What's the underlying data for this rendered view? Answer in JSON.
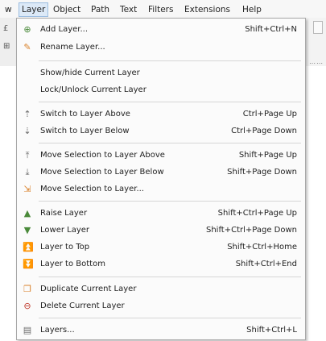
{
  "menubar": {
    "items": [
      {
        "label": "w"
      },
      {
        "label": "Layer"
      },
      {
        "label": "Object"
      },
      {
        "label": "Path"
      },
      {
        "label": "Text"
      },
      {
        "label": "Filters"
      },
      {
        "label": "Extensions"
      },
      {
        "label": "Help"
      }
    ]
  },
  "layer_menu": {
    "items": [
      {
        "label": "Add Layer...",
        "shortcut": "Shift+Ctrl+N",
        "icon": "add-layer-icon"
      },
      {
        "label": "Rename Layer...",
        "shortcut": "",
        "icon": "rename-layer-icon"
      },
      {
        "label": "Show/hide Current Layer",
        "shortcut": "",
        "icon": ""
      },
      {
        "label": "Lock/Unlock Current Layer",
        "shortcut": "",
        "icon": ""
      },
      {
        "label": "Switch to Layer Above",
        "shortcut": "Ctrl+Page Up",
        "icon": "switch-layer-above-icon"
      },
      {
        "label": "Switch to Layer Below",
        "shortcut": "Ctrl+Page Down",
        "icon": "switch-layer-below-icon"
      },
      {
        "label": "Move Selection to Layer Above",
        "shortcut": "Shift+Page Up",
        "icon": "move-selection-above-icon"
      },
      {
        "label": "Move Selection to Layer Below",
        "shortcut": "Shift+Page Down",
        "icon": "move-selection-below-icon"
      },
      {
        "label": "Move Selection to Layer...",
        "shortcut": "",
        "icon": "move-selection-to-layer-icon"
      },
      {
        "label": "Raise Layer",
        "shortcut": "Shift+Ctrl+Page Up",
        "icon": "raise-layer-icon"
      },
      {
        "label": "Lower Layer",
        "shortcut": "Shift+Ctrl+Page Down",
        "icon": "lower-layer-icon"
      },
      {
        "label": "Layer to Top",
        "shortcut": "Shift+Ctrl+Home",
        "icon": "layer-to-top-icon"
      },
      {
        "label": "Layer to Bottom",
        "shortcut": "Shift+Ctrl+End",
        "icon": "layer-to-bottom-icon"
      },
      {
        "label": "Duplicate Current Layer",
        "shortcut": "",
        "icon": "duplicate-layer-icon"
      },
      {
        "label": "Delete Current Layer",
        "shortcut": "",
        "icon": "delete-layer-icon"
      },
      {
        "label": "Layers...",
        "shortcut": "Shift+Ctrl+L",
        "icon": "layers-dialog-icon"
      }
    ]
  },
  "colors": {
    "menu_highlight": "#dce9f7",
    "menu_highlight_border": "#9bbde0",
    "icon_green": "#4a8a3a",
    "icon_orange": "#d9822b",
    "icon_red": "#c0392b",
    "icon_gray": "#6b6b6b"
  }
}
